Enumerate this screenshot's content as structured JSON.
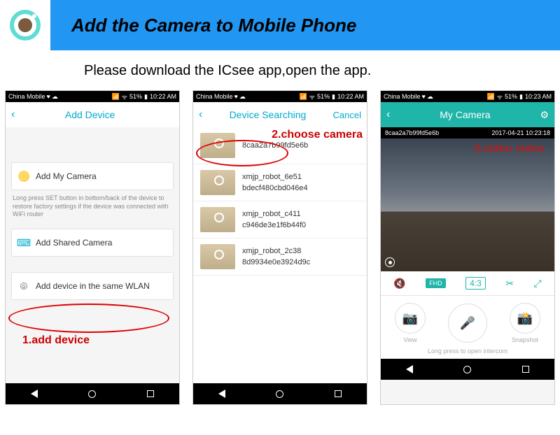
{
  "header": {
    "title": "Add the Camera to Mobile Phone"
  },
  "subheading": "Please download the ICsee app,open the app.",
  "status": {
    "carrier": "China Mobile",
    "battery": "51%",
    "time1": "10:22 AM",
    "time2": "10:22 AM",
    "time3": "10:23 AM"
  },
  "screen1": {
    "title": "Add Device",
    "opt1": "Add My Camera",
    "help": "Long press SET button in bottom/back of the device to restore factory settings if the device was connected with WiFi router",
    "opt2": "Add Shared Camera",
    "opt3": "Add device in the same WLAN",
    "annotation": "1.add device"
  },
  "screen2": {
    "title": "Device Searching",
    "cancel": "Cancel",
    "annotation": "2.choose camera",
    "devices": [
      {
        "id": "8caa2a7b99fd5e6b"
      },
      {
        "line1": "xmjp_robot_6e51",
        "line2": "bdecf480cbd046e4"
      },
      {
        "line1": "xmjp_robot_c411",
        "line2": "c946de3e1f6b44f0"
      },
      {
        "line1": "xmjp_robot_2c38",
        "line2": "8d9934e0e3924d9c"
      }
    ]
  },
  "screen3": {
    "title": "My Camera",
    "cam_id": "8caa2a7b99fd5e6b",
    "timestamp": "2017-04-21 10:23:18",
    "annotation": "3.video video",
    "fhd": "FHD",
    "ratio": "4:3",
    "view": "View",
    "snapshot": "Snapshot",
    "hint": "Long press to open intercom"
  }
}
